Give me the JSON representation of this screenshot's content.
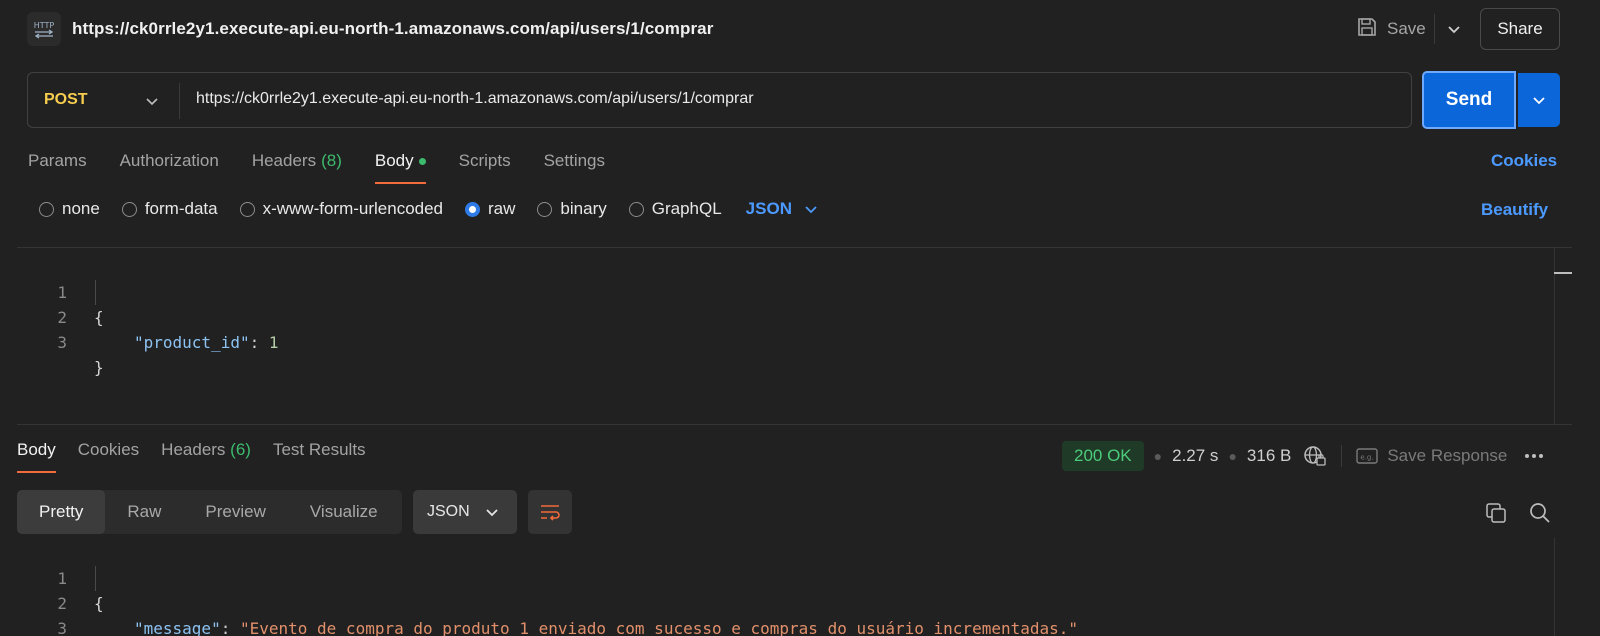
{
  "header": {
    "icon": "http-icon",
    "title": "https://ck0rrle2y1.execute-api.eu-north-1.amazonaws.com/api/users/1/comprar",
    "save_label": "Save",
    "share_label": "Share"
  },
  "request": {
    "method": "POST",
    "url": "https://ck0rrle2y1.execute-api.eu-north-1.amazonaws.com/api/users/1/comprar",
    "send_label": "Send"
  },
  "request_tabs": {
    "params": "Params",
    "authorization": "Authorization",
    "headers": "Headers",
    "headers_count": "(8)",
    "body": "Body",
    "scripts": "Scripts",
    "settings": "Settings",
    "cookies": "Cookies"
  },
  "body_types": {
    "none": "none",
    "form_data": "form-data",
    "urlencoded": "x-www-form-urlencoded",
    "raw": "raw",
    "binary": "binary",
    "graphql": "GraphQL",
    "selected": "raw",
    "language": "JSON",
    "beautify": "Beautify"
  },
  "request_body": {
    "lines": [
      "1",
      "2",
      "3"
    ],
    "open": "{",
    "key": "\"product_id\"",
    "colon": ": ",
    "value": "1",
    "close": "}"
  },
  "response_tabs": {
    "body": "Body",
    "cookies": "Cookies",
    "headers": "Headers",
    "headers_count": "(6)",
    "test_results": "Test Results"
  },
  "response_status": {
    "status": "200 OK",
    "time": "2.27 s",
    "size": "316 B",
    "save_response": "Save Response",
    "colors": {
      "ok": "#4ccb7c",
      "accent": "#f26b3a",
      "link": "#4c9aff",
      "send": "#0a66d9"
    }
  },
  "response_view": {
    "pretty": "Pretty",
    "raw": "Raw",
    "preview": "Preview",
    "visualize": "Visualize",
    "format": "JSON"
  },
  "response_body": {
    "lines": [
      "1",
      "2",
      "3"
    ],
    "open": "{",
    "key": "\"message\"",
    "colon": ": ",
    "value": "\"Evento de compra do produto 1 enviado com sucesso e compras do usuário incrementadas.\"",
    "close": "}"
  }
}
